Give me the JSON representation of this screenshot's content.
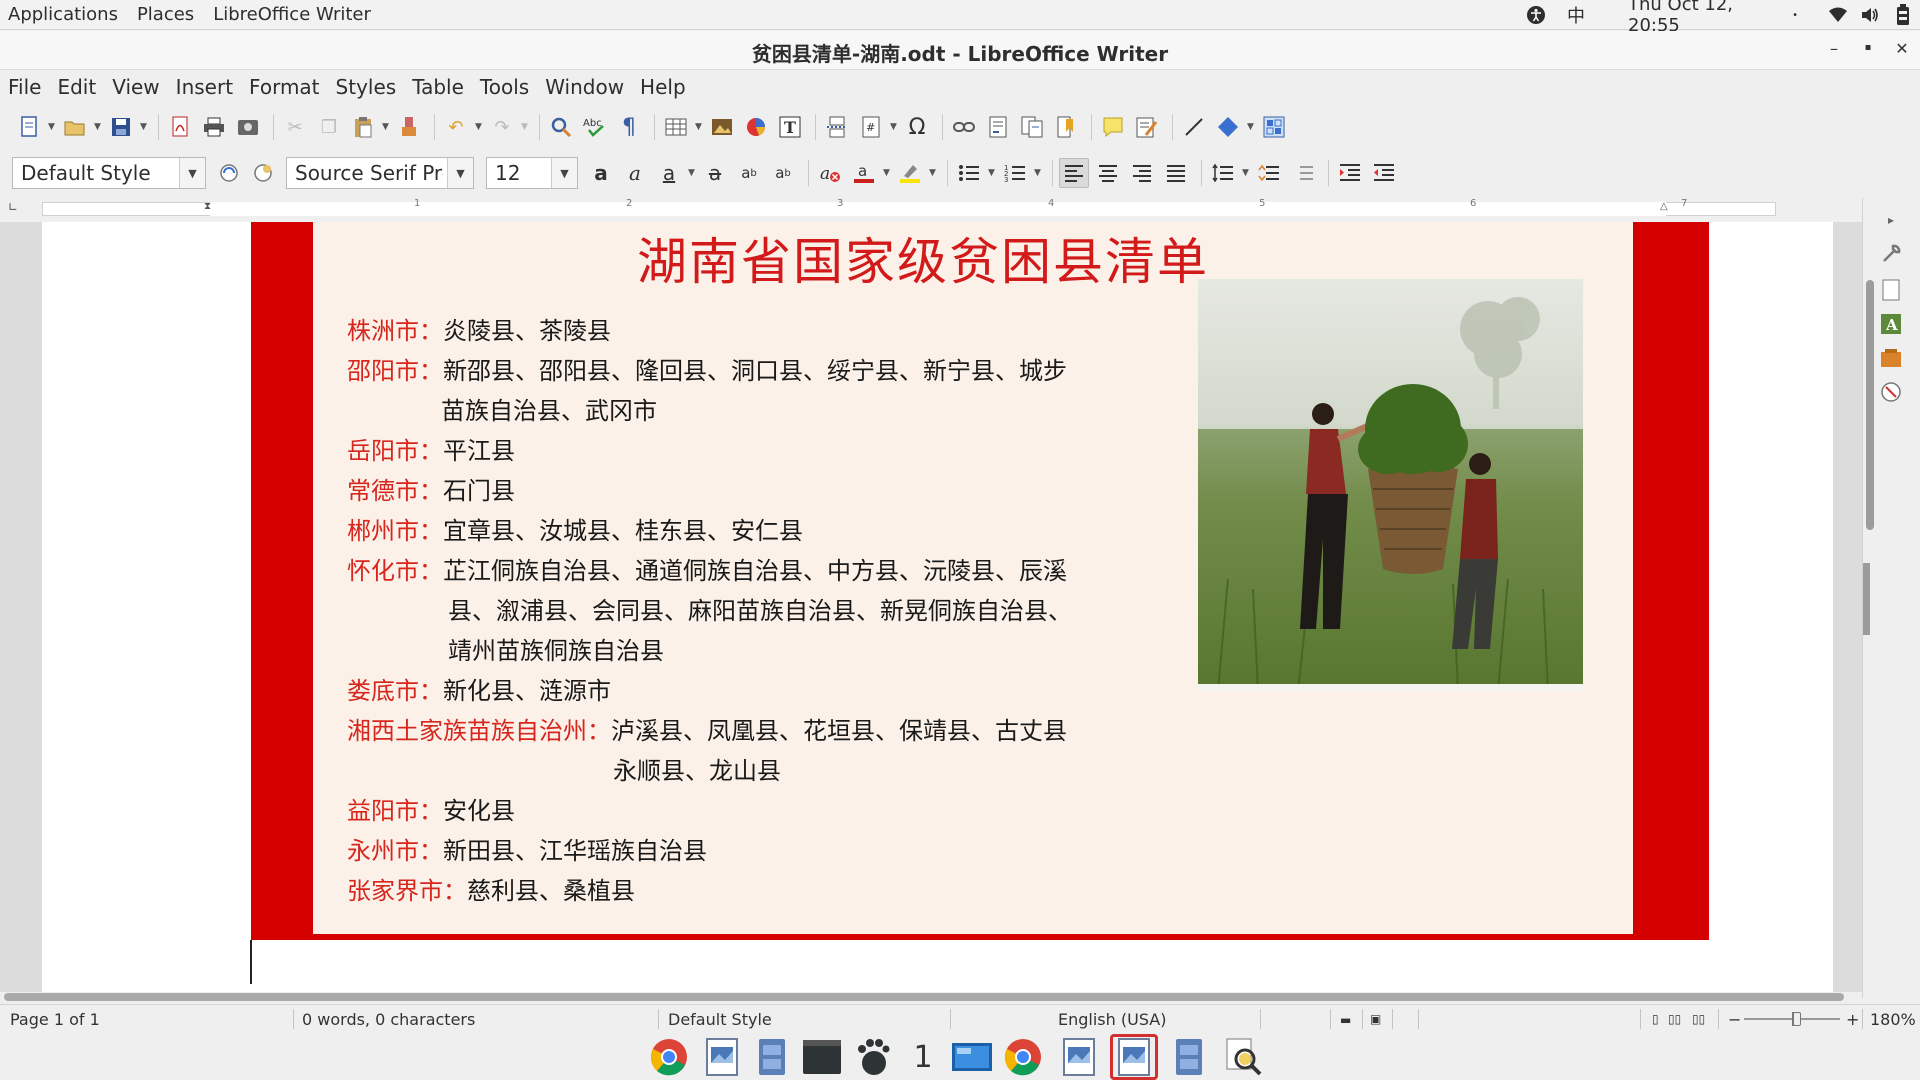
{
  "topbar": {
    "applications": "Applications",
    "places": "Places",
    "active_app": "LibreOffice Writer",
    "input_method": "中",
    "datetime": "Thu Oct 12, 20:55",
    "datetime_dot": "•"
  },
  "window": {
    "title": "贫困县清单-湖南.odt - LibreOffice Writer",
    "minimize": "–",
    "maximize": "▪",
    "close": "✕"
  },
  "menubar": {
    "items": [
      "File",
      "Edit",
      "View",
      "Insert",
      "Format",
      "Styles",
      "Table",
      "Tools",
      "Window",
      "Help"
    ]
  },
  "formatting": {
    "paragraph_style": "Default Style",
    "font_name": "Source Serif Pro",
    "font_size": "12"
  },
  "document": {
    "heading": "湖南省国家级贫困县清单",
    "entries": [
      {
        "city": "株洲市：",
        "counties": "炎陵县、茶陵县",
        "cont": ""
      },
      {
        "city": "邵阳市：",
        "counties": "新邵县、邵阳县、隆回县、洞口县、绥宁县、新宁县、城步",
        "cont": "苗族自治县、武冈市"
      },
      {
        "city": "岳阳市：",
        "counties": "平江县",
        "cont": ""
      },
      {
        "city": "常德市：",
        "counties": "石门县",
        "cont": ""
      },
      {
        "city": "郴州市：",
        "counties": "宜章县、汝城县、桂东县、安仁县",
        "cont": ""
      },
      {
        "city": "怀化市：",
        "counties": "芷江侗族自治县、通道侗族自治县、中方县、沅陵县、辰溪",
        "cont": "县、溆浦县、会同县、麻阳苗族自治县、新晃侗族自治县、",
        "cont2": "靖州苗族侗族自治县"
      },
      {
        "city": "娄底市：",
        "counties": "新化县、涟源市",
        "cont": ""
      },
      {
        "city": "湘西土家族苗族自治州：",
        "counties": "泸溪县、凤凰县、花垣县、保靖县、古丈县",
        "cont": "永顺县、龙山县"
      },
      {
        "city": "益阳市：",
        "counties": "安化县",
        "cont": ""
      },
      {
        "city": "永州市：",
        "counties": "新田县、江华瑶族自治县",
        "cont": ""
      },
      {
        "city": "张家界市：",
        "counties": "慈利县、桑植县",
        "cont": ""
      }
    ]
  },
  "ruler": {
    "numbers": [
      "1",
      "1",
      "2",
      "3",
      "4",
      "5",
      "6",
      "7"
    ]
  },
  "statusbar": {
    "page": "Page 1 of 1",
    "words": "0 words, 0 characters",
    "style": "Default Style",
    "language": "English (USA)",
    "zoom": "180%",
    "zoom_minus": "−",
    "zoom_plus": "+"
  },
  "dock": {
    "workspace": "1"
  },
  "colors": {
    "frame_red": "#d40000",
    "city_red": "#d7261e",
    "heading_red": "#d21a1a",
    "panel_bg": "#fbf1e8"
  }
}
